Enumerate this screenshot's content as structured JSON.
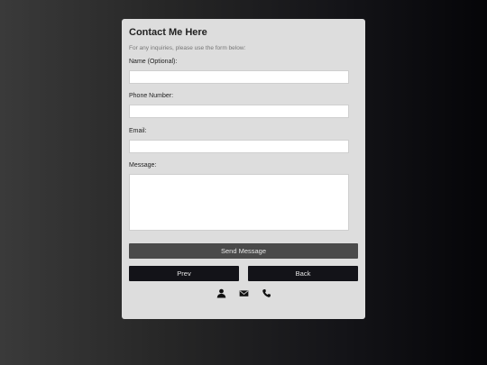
{
  "form": {
    "title": "Contact Me Here",
    "subtitle": "For any inquiries, please use the form below:",
    "name_label": "Name (Optional):",
    "name_value": "",
    "phone_label": "Phone Number:",
    "phone_value": "",
    "email_label": "Email:",
    "email_value": "",
    "message_label": "Message:",
    "message_value": "",
    "send_label": "Send Message",
    "prev_label": "Prev",
    "back_label": "Back"
  },
  "icons": [
    "user-icon",
    "envelope-icon",
    "phone-icon"
  ],
  "colors": {
    "card_bg": "#dddddd",
    "send_button": "#4a4a4a",
    "nav_button": "#131318"
  }
}
